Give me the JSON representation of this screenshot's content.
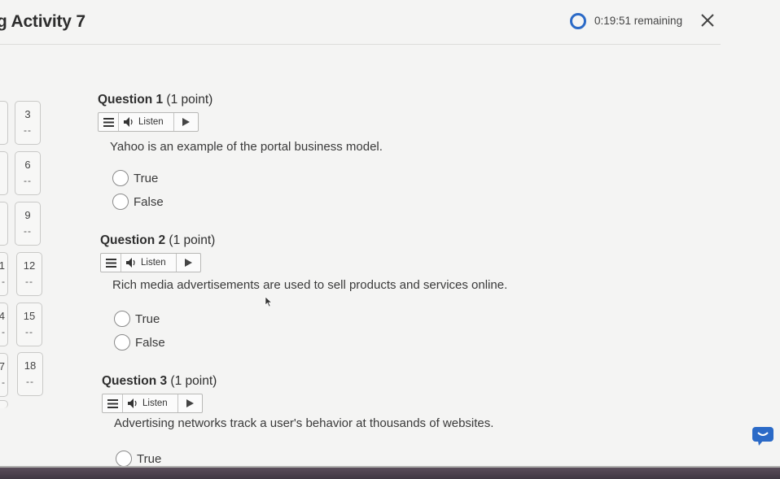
{
  "header": {
    "title": "g Activity 7",
    "timer": "0:19:51 remaining",
    "accent_color": "#2b6ac7"
  },
  "nav": {
    "cells": [
      {
        "num": "3",
        "dash": "--"
      },
      {
        "num": "6",
        "dash": "--"
      },
      {
        "num": "9",
        "dash": "--"
      },
      {
        "num": "12",
        "dash": "--"
      },
      {
        "num": "15",
        "dash": "--"
      },
      {
        "num": "18",
        "dash": "--"
      }
    ],
    "partial": [
      {
        "num": "",
        "dash": ""
      },
      {
        "num": "",
        "dash": ""
      },
      {
        "num": "",
        "dash": ""
      },
      {
        "num": "1",
        "dash": "-"
      },
      {
        "num": "4",
        "dash": "-"
      },
      {
        "num": "7",
        "dash": "-"
      }
    ]
  },
  "questions": [
    {
      "label": "Question 1",
      "points": "(1 point)",
      "listen": "Listen",
      "text": "Yahoo is an example of the portal business model.",
      "options": [
        "True",
        "False"
      ]
    },
    {
      "label": "Question 2",
      "points": "(1 point)",
      "listen": "Listen",
      "text": "Rich media advertisements are used to sell products and services online.",
      "options": [
        "True",
        "False"
      ]
    },
    {
      "label": "Question 3",
      "points": "(1 point)",
      "listen": "Listen",
      "text": "Advertising networks track a user's behavior at thousands of websites.",
      "options": [
        "True"
      ]
    }
  ],
  "icons": {
    "close": "close-icon",
    "timer": "timer-ring-icon",
    "menu": "menu-icon",
    "speaker": "speaker-icon",
    "play": "play-icon",
    "chat": "chat-icon"
  }
}
